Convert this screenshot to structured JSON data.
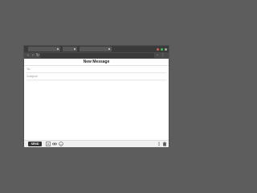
{
  "window": {
    "tabs": [
      {
        "label": ""
      },
      {
        "label": ""
      },
      {
        "label": ""
      }
    ],
    "window_controls": [
      {
        "name": "close",
        "color": "#e25a4f"
      },
      {
        "name": "minimize",
        "color": "#3ec24d"
      },
      {
        "name": "maximize",
        "color": "#a9a9a9"
      }
    ],
    "address": {
      "value": ""
    }
  },
  "compose": {
    "title": "New Message",
    "to": {
      "placeholder": "To:",
      "value": ""
    },
    "subject": {
      "placeholder": "Subject:",
      "value": ""
    },
    "body": ""
  },
  "toolbar": {
    "send_label": "SEND",
    "icons": [
      "font-format-icon",
      "attach-link-icon",
      "insert-emoji-icon",
      "more-options-icon",
      "trash-icon"
    ]
  },
  "colors": {
    "desktop": "#5d5d5d",
    "titlebar": "#3b3b3b",
    "navbar": "#4a4a4a",
    "send_button": "#333333"
  }
}
